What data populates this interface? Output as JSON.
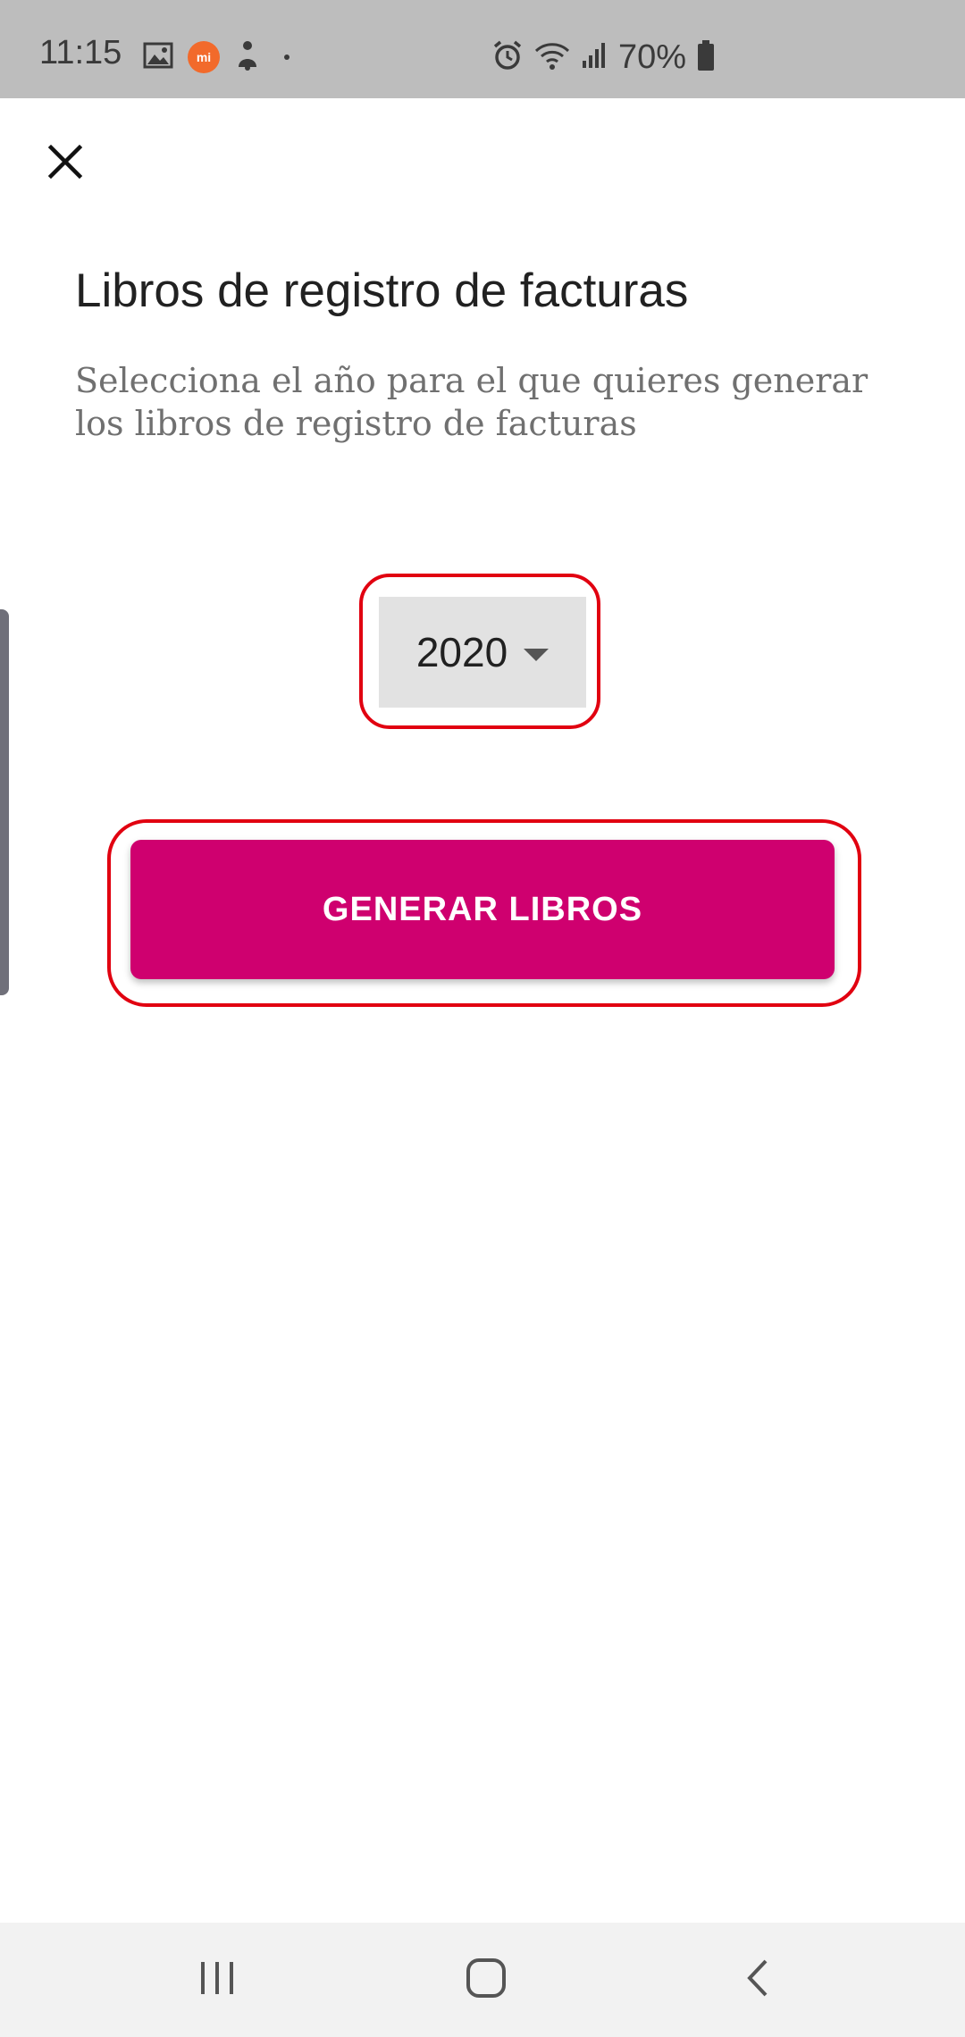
{
  "status_bar": {
    "time": "11:15",
    "battery_percent": "70%",
    "icons": [
      "gallery-icon",
      "mi-icon",
      "bell-person-icon",
      "dot-icon",
      "alarm-icon",
      "wifi-icon",
      "signal-icon",
      "battery-icon"
    ],
    "mi_label": "mi"
  },
  "dialog": {
    "close_icon": "close-icon",
    "title": "Libros de registro de facturas",
    "subtitle": "Selecciona el año para el que quieres generar los libros de registro de facturas",
    "year_select": {
      "selected": "2020",
      "icon": "chevron-down-icon"
    },
    "primary_button": {
      "label": "GENERAR LIBROS",
      "color": "#cf006f"
    },
    "highlight_color": "#e10010"
  },
  "nav_bar": {
    "buttons": [
      "recent-apps-icon",
      "home-icon",
      "back-icon"
    ]
  }
}
